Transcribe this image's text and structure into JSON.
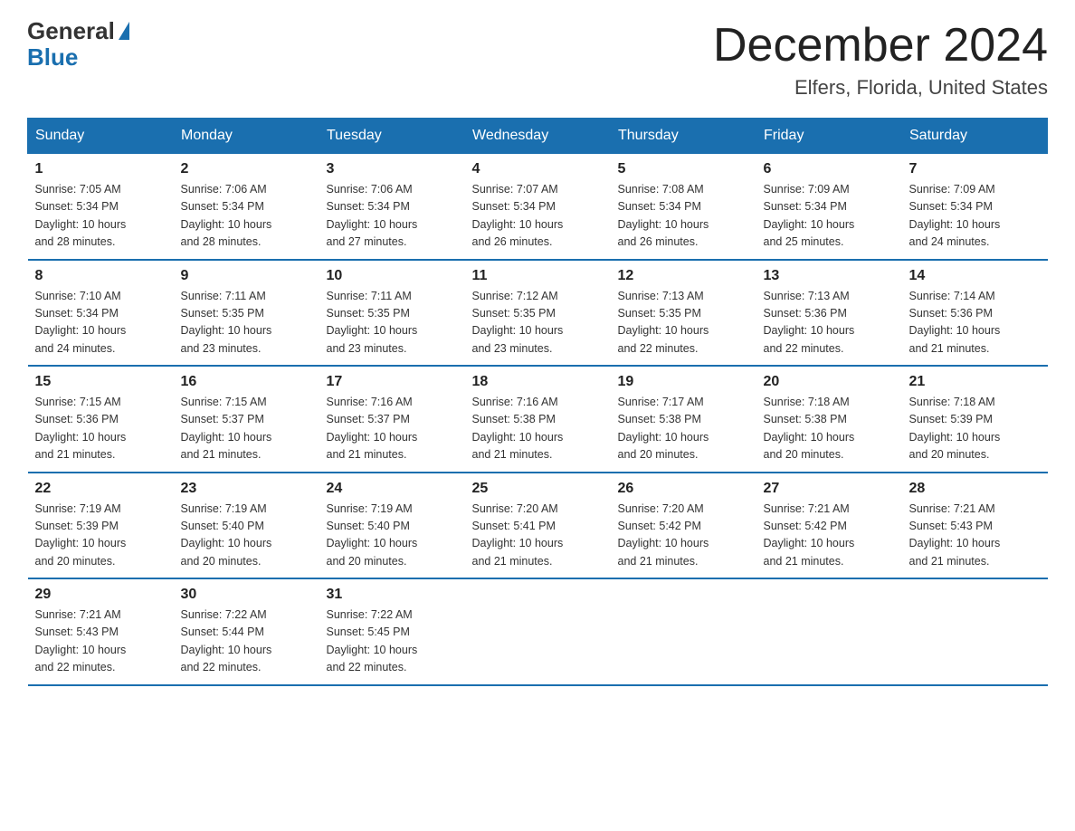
{
  "logo": {
    "general": "General",
    "blue": "Blue"
  },
  "title": "December 2024",
  "subtitle": "Elfers, Florida, United States",
  "days_of_week": [
    "Sunday",
    "Monday",
    "Tuesday",
    "Wednesday",
    "Thursday",
    "Friday",
    "Saturday"
  ],
  "weeks": [
    [
      {
        "day": "1",
        "sunrise": "7:05 AM",
        "sunset": "5:34 PM",
        "daylight": "10 hours and 28 minutes."
      },
      {
        "day": "2",
        "sunrise": "7:06 AM",
        "sunset": "5:34 PM",
        "daylight": "10 hours and 28 minutes."
      },
      {
        "day": "3",
        "sunrise": "7:06 AM",
        "sunset": "5:34 PM",
        "daylight": "10 hours and 27 minutes."
      },
      {
        "day": "4",
        "sunrise": "7:07 AM",
        "sunset": "5:34 PM",
        "daylight": "10 hours and 26 minutes."
      },
      {
        "day": "5",
        "sunrise": "7:08 AM",
        "sunset": "5:34 PM",
        "daylight": "10 hours and 26 minutes."
      },
      {
        "day": "6",
        "sunrise": "7:09 AM",
        "sunset": "5:34 PM",
        "daylight": "10 hours and 25 minutes."
      },
      {
        "day": "7",
        "sunrise": "7:09 AM",
        "sunset": "5:34 PM",
        "daylight": "10 hours and 24 minutes."
      }
    ],
    [
      {
        "day": "8",
        "sunrise": "7:10 AM",
        "sunset": "5:34 PM",
        "daylight": "10 hours and 24 minutes."
      },
      {
        "day": "9",
        "sunrise": "7:11 AM",
        "sunset": "5:35 PM",
        "daylight": "10 hours and 23 minutes."
      },
      {
        "day": "10",
        "sunrise": "7:11 AM",
        "sunset": "5:35 PM",
        "daylight": "10 hours and 23 minutes."
      },
      {
        "day": "11",
        "sunrise": "7:12 AM",
        "sunset": "5:35 PM",
        "daylight": "10 hours and 23 minutes."
      },
      {
        "day": "12",
        "sunrise": "7:13 AM",
        "sunset": "5:35 PM",
        "daylight": "10 hours and 22 minutes."
      },
      {
        "day": "13",
        "sunrise": "7:13 AM",
        "sunset": "5:36 PM",
        "daylight": "10 hours and 22 minutes."
      },
      {
        "day": "14",
        "sunrise": "7:14 AM",
        "sunset": "5:36 PM",
        "daylight": "10 hours and 21 minutes."
      }
    ],
    [
      {
        "day": "15",
        "sunrise": "7:15 AM",
        "sunset": "5:36 PM",
        "daylight": "10 hours and 21 minutes."
      },
      {
        "day": "16",
        "sunrise": "7:15 AM",
        "sunset": "5:37 PM",
        "daylight": "10 hours and 21 minutes."
      },
      {
        "day": "17",
        "sunrise": "7:16 AM",
        "sunset": "5:37 PM",
        "daylight": "10 hours and 21 minutes."
      },
      {
        "day": "18",
        "sunrise": "7:16 AM",
        "sunset": "5:38 PM",
        "daylight": "10 hours and 21 minutes."
      },
      {
        "day": "19",
        "sunrise": "7:17 AM",
        "sunset": "5:38 PM",
        "daylight": "10 hours and 20 minutes."
      },
      {
        "day": "20",
        "sunrise": "7:18 AM",
        "sunset": "5:38 PM",
        "daylight": "10 hours and 20 minutes."
      },
      {
        "day": "21",
        "sunrise": "7:18 AM",
        "sunset": "5:39 PM",
        "daylight": "10 hours and 20 minutes."
      }
    ],
    [
      {
        "day": "22",
        "sunrise": "7:19 AM",
        "sunset": "5:39 PM",
        "daylight": "10 hours and 20 minutes."
      },
      {
        "day": "23",
        "sunrise": "7:19 AM",
        "sunset": "5:40 PM",
        "daylight": "10 hours and 20 minutes."
      },
      {
        "day": "24",
        "sunrise": "7:19 AM",
        "sunset": "5:40 PM",
        "daylight": "10 hours and 20 minutes."
      },
      {
        "day": "25",
        "sunrise": "7:20 AM",
        "sunset": "5:41 PM",
        "daylight": "10 hours and 21 minutes."
      },
      {
        "day": "26",
        "sunrise": "7:20 AM",
        "sunset": "5:42 PM",
        "daylight": "10 hours and 21 minutes."
      },
      {
        "day": "27",
        "sunrise": "7:21 AM",
        "sunset": "5:42 PM",
        "daylight": "10 hours and 21 minutes."
      },
      {
        "day": "28",
        "sunrise": "7:21 AM",
        "sunset": "5:43 PM",
        "daylight": "10 hours and 21 minutes."
      }
    ],
    [
      {
        "day": "29",
        "sunrise": "7:21 AM",
        "sunset": "5:43 PM",
        "daylight": "10 hours and 22 minutes."
      },
      {
        "day": "30",
        "sunrise": "7:22 AM",
        "sunset": "5:44 PM",
        "daylight": "10 hours and 22 minutes."
      },
      {
        "day": "31",
        "sunrise": "7:22 AM",
        "sunset": "5:45 PM",
        "daylight": "10 hours and 22 minutes."
      },
      null,
      null,
      null,
      null
    ]
  ],
  "labels": {
    "sunrise": "Sunrise:",
    "sunset": "Sunset:",
    "daylight": "Daylight:"
  }
}
